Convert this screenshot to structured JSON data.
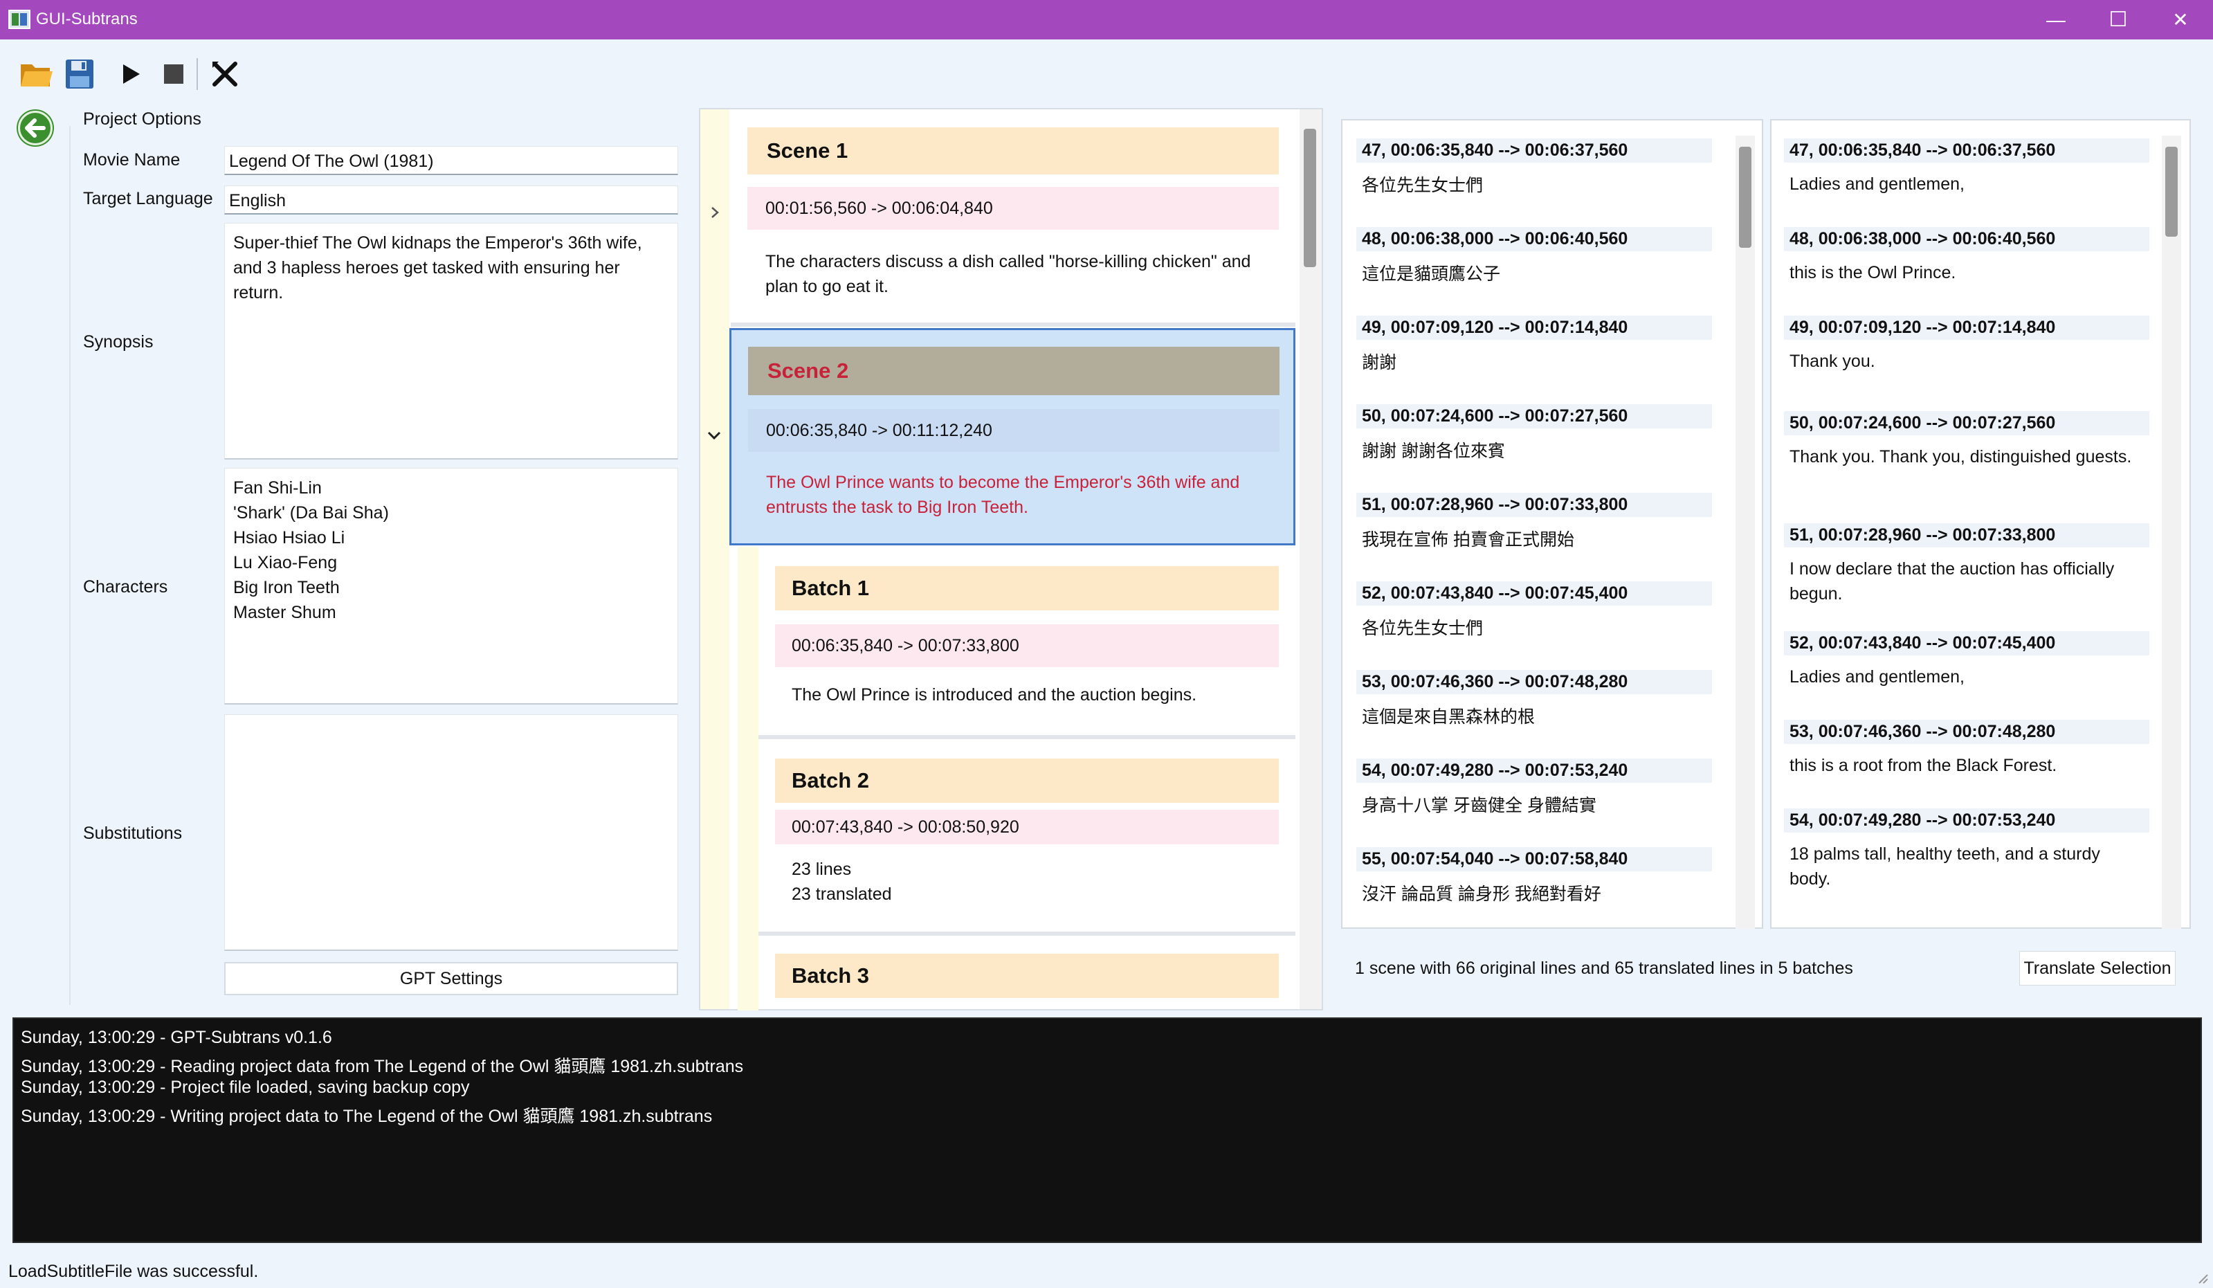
{
  "window": {
    "title": "GUI-Subtrans",
    "minimize": "—",
    "maximize": "☐",
    "close": "✕"
  },
  "toolbar": {
    "items": [
      {
        "name": "open",
        "icon": "folder-open-icon"
      },
      {
        "name": "save",
        "icon": "floppy-save-icon"
      },
      {
        "name": "start",
        "icon": "play-icon"
      },
      {
        "name": "stop",
        "icon": "stop-icon"
      },
      {
        "name": "quit",
        "icon": "quit-x-icon"
      }
    ]
  },
  "back": {
    "icon": "arrow-left-icon"
  },
  "project_options": {
    "title": "Project Options",
    "movie_name": {
      "label": "Movie Name",
      "value": "Legend Of The Owl (1981)"
    },
    "target_language": {
      "label": "Target Language",
      "value": "English"
    },
    "synopsis": {
      "label": "Synopsis",
      "value": "Super-thief The Owl kidnaps the Emperor's 36th wife, and 3 hapless heroes get tasked with ensuring her return."
    },
    "characters": {
      "label": "Characters",
      "value": "Fan Shi-Lin\n'Shark' (Da Bai Sha)\nHsiao Hsiao Li\nLu Xiao-Feng\nBig Iron Teeth\nMaster Shum"
    },
    "substitutions": {
      "label": "Substitutions",
      "value": ""
    },
    "gpt_settings_label": "GPT Settings"
  },
  "scenes": {
    "expand_icon": "chevron-right-icon",
    "collapse_icon": "chevron-down-icon",
    "scene1": {
      "title": "Scene 1",
      "time": "00:01:56,560 -> 00:06:04,840",
      "summary": "The characters discuss a dish called \"horse-killing chicken\" and plan to go eat it."
    },
    "scene2": {
      "title": "Scene 2",
      "time": "00:06:35,840 -> 00:11:12,240",
      "summary": "The Owl Prince wants to become the Emperor's 36th wife and entrusts the task to Big Iron Teeth."
    },
    "batch1": {
      "title": "Batch 1",
      "time": "00:06:35,840 -> 00:07:33,800",
      "summary": "The Owl Prince is introduced and the auction begins."
    },
    "batch2": {
      "title": "Batch 2",
      "time": "00:07:43,840 -> 00:08:50,920",
      "summary": "23 lines\n23 translated"
    },
    "batch3": {
      "title": "Batch 3"
    }
  },
  "original": {
    "lines": [
      {
        "header": "47, 00:06:35,840 --> 00:06:37,560",
        "text": "各位先生女士們"
      },
      {
        "header": "48, 00:06:38,000 --> 00:06:40,560",
        "text": "這位是貓頭鷹公子"
      },
      {
        "header": "49, 00:07:09,120 --> 00:07:14,840",
        "text": "謝謝"
      },
      {
        "header": "50, 00:07:24,600 --> 00:07:27,560",
        "text": "謝謝 謝謝各位來賓"
      },
      {
        "header": "51, 00:07:28,960 --> 00:07:33,800",
        "text": "我現在宣佈 拍賣會正式開始"
      },
      {
        "header": "52, 00:07:43,840 --> 00:07:45,400",
        "text": "各位先生女士們"
      },
      {
        "header": "53, 00:07:46,360 --> 00:07:48,280",
        "text": "這個是來自黑森林的根"
      },
      {
        "header": "54, 00:07:49,280 --> 00:07:53,240",
        "text": "身高十八掌 牙齒健全 身體結實"
      },
      {
        "header": "55, 00:07:54,040 --> 00:07:58,840",
        "text": "沒汗 論品質 論身形 我絕對看好"
      }
    ]
  },
  "translated": {
    "lines": [
      {
        "header": "47, 00:06:35,840 --> 00:06:37,560",
        "text": "Ladies and gentlemen,"
      },
      {
        "header": "48, 00:06:38,000 --> 00:06:40,560",
        "text": "this is the Owl Prince."
      },
      {
        "header": "49, 00:07:09,120 --> 00:07:14,840",
        "text": "Thank you."
      },
      {
        "header": "50, 00:07:24,600 --> 00:07:27,560",
        "text": "Thank you. Thank you, distinguished guests."
      },
      {
        "header": "51, 00:07:28,960 --> 00:07:33,800",
        "text": "I now declare that the auction has officially begun."
      },
      {
        "header": "52, 00:07:43,840 --> 00:07:45,400",
        "text": "Ladies and gentlemen,"
      },
      {
        "header": "53, 00:07:46,360 --> 00:07:48,280",
        "text": "this is a root from the Black Forest."
      },
      {
        "header": "54, 00:07:49,280 --> 00:07:53,240",
        "text": "18 palms tall, healthy teeth, and a sturdy body."
      }
    ]
  },
  "status_summary": "1 scene with 66 original lines and 65 translated lines in 5 batches",
  "translate_selection_label": "Translate Selection",
  "log": [
    "Sunday, 13:00:29 - GPT-Subtrans v0.1.6",
    "Sunday, 13:00:29 - Reading project data from The Legend of the Owl 貓頭鷹 1981.zh.subtrans",
    "Sunday, 13:00:29 - Project file loaded, saving backup copy",
    "Sunday, 13:00:29 - Writing project data to The Legend of the Owl 貓頭鷹 1981.zh.subtrans"
  ],
  "status_bar": "LoadSubtitleFile was successful.",
  "colors": {
    "title_bar": "#a348bd",
    "selected_scene_bg": "#cfe3f8",
    "selected_scene_border": "#4178c9",
    "selected_scene_title": "#c8223a",
    "card_header": "#fde9c8",
    "card_time": "#fde8ef",
    "log_bg": "#111111"
  }
}
